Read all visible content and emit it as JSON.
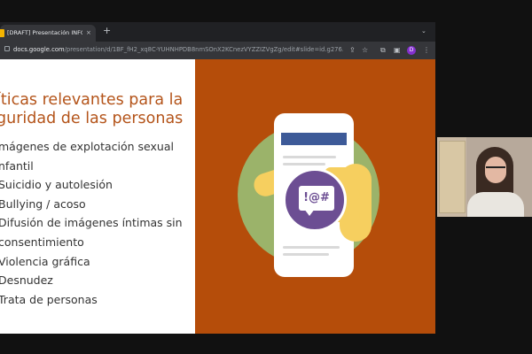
{
  "browser": {
    "tab": {
      "title": "[DRAFT] Presentación INFO.Ma",
      "close_label": "×"
    },
    "new_tab_label": "+",
    "tab_search_label": "⌄",
    "address": {
      "host": "docs.google.com",
      "path": "/presentation/d/1BF_fH2_xq8C-YUHNHPDB8nmSOnX2KCnezVYZZIZVgZg/edit#slide=id.g276..."
    },
    "toolbar_icons": {
      "share": "⇪",
      "bookmark": "☆",
      "extensions": "⧉",
      "sidepanel": "▣",
      "menu": "⋮"
    },
    "profile_initial": "D"
  },
  "slide": {
    "title_line1": "íticas relevantes para la",
    "title_line2": "guridad de las personas",
    "bullets": [
      "mágenes de explotación sexual",
      "nfantil",
      "Suicidio y autolesión",
      "Bullying / acoso",
      "Difusión de imágenes íntimas sin",
      "consentimiento",
      "Violencia gráfica",
      "Desnudez",
      "Trata de personas"
    ],
    "illustration": {
      "bubble_text": "!@#"
    }
  },
  "colors": {
    "title": "#b4541a",
    "panel": "#b54d0a",
    "circle": "#9bb36a",
    "badge": "#6c4e93",
    "hand": "#f6cf5f",
    "phone_bar": "#3d5a98"
  }
}
